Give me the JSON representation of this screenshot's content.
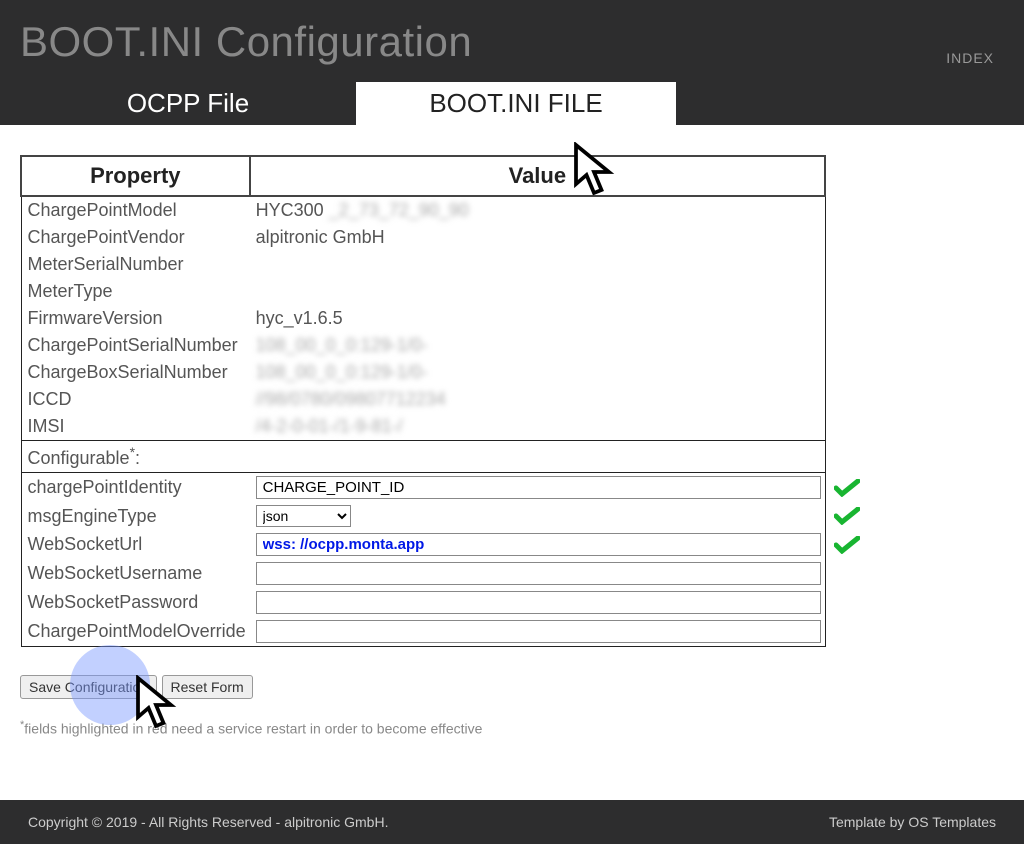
{
  "header": {
    "title": "BOOT.INI Configuration",
    "index_link": "INDEX"
  },
  "tabs": {
    "ocpp": "OCPP File",
    "bootini": "BOOT.INI FILE"
  },
  "table_headers": {
    "property": "Property",
    "value": "Value"
  },
  "readonly_rows": [
    {
      "property": "ChargePointModel",
      "value": "HYC300",
      "blurred_extra": "_2_73_72_90_90"
    },
    {
      "property": "ChargePointVendor",
      "value": "alpitronic GmbH"
    },
    {
      "property": "MeterSerialNumber",
      "value": ""
    },
    {
      "property": "MeterType",
      "value": ""
    },
    {
      "property": "FirmwareVersion",
      "value": "hyc_v1.6.5"
    },
    {
      "property": "ChargePointSerialNumber",
      "value": "",
      "blurred_extra": "108_00_0_0:129-1/0-"
    },
    {
      "property": "ChargeBoxSerialNumber",
      "value": "",
      "blurred_extra": "108_00_0_0:129-1/0-"
    },
    {
      "property": "ICCD",
      "value": "",
      "blurred_extra": "//98/0780/09807712234"
    },
    {
      "property": "IMSI",
      "value": "",
      "blurred_extra": "/4-2-0-01-/1-9-81-/"
    }
  ],
  "configurable_header": "Configurable",
  "configurable_rows": {
    "chargePointIdentity": {
      "label": "chargePointIdentity",
      "value": "CHARGE_POINT_ID",
      "type": "text",
      "check": true
    },
    "msgEngineType": {
      "label": "msgEngineType",
      "value": "json",
      "type": "select",
      "check": true
    },
    "WebSocketUrl": {
      "label": "WebSocketUrl",
      "value": "wss: //ocpp.monta.app",
      "type": "text",
      "check": true,
      "ws": true
    },
    "WebSocketUsername": {
      "label": "WebSocketUsername",
      "value": "",
      "type": "text"
    },
    "WebSocketPassword": {
      "label": "WebSocketPassword",
      "value": "",
      "type": "text"
    },
    "ChargePointModelOverride": {
      "label": "ChargePointModelOverride",
      "value": "",
      "type": "text"
    }
  },
  "buttons": {
    "save": "Save Configuration",
    "reset": "Reset Form"
  },
  "hint": "fields highlighted in red need a service restart in order to become effective",
  "footer": {
    "copyright": "Copyright © 2019 - All Rights Reserved - alpitronic GmbH.",
    "template_prefix": "Template by ",
    "template_link": "OS Templates"
  }
}
